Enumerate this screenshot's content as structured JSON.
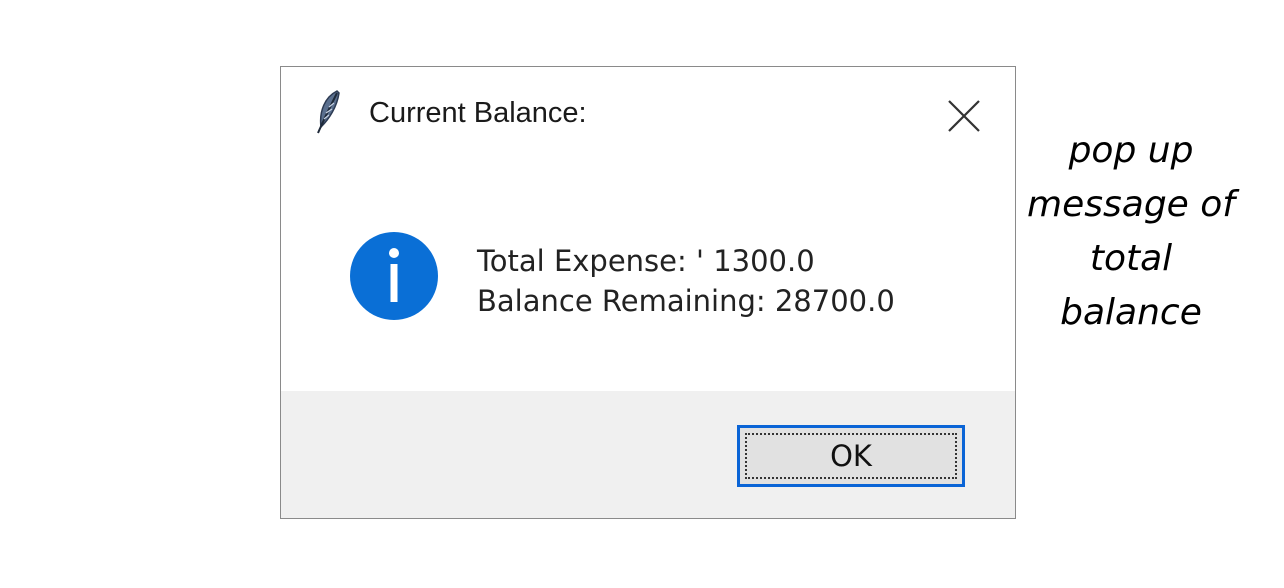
{
  "dialog": {
    "title": "Current Balance:",
    "icon": "feather-icon",
    "close_icon": "close-icon",
    "message_icon": "info-icon",
    "message_lines": [
      "Total Expense: ' 1300.0",
      "Balance Remaining: 28700.0"
    ],
    "ok_label": "OK",
    "colors": {
      "info_blue": "#0a6fd6",
      "focus_border": "#0a64d6",
      "footer_bg": "#f0f0f0"
    }
  },
  "caption": {
    "lines": [
      "pop up",
      "message of",
      "total",
      "balance"
    ]
  }
}
